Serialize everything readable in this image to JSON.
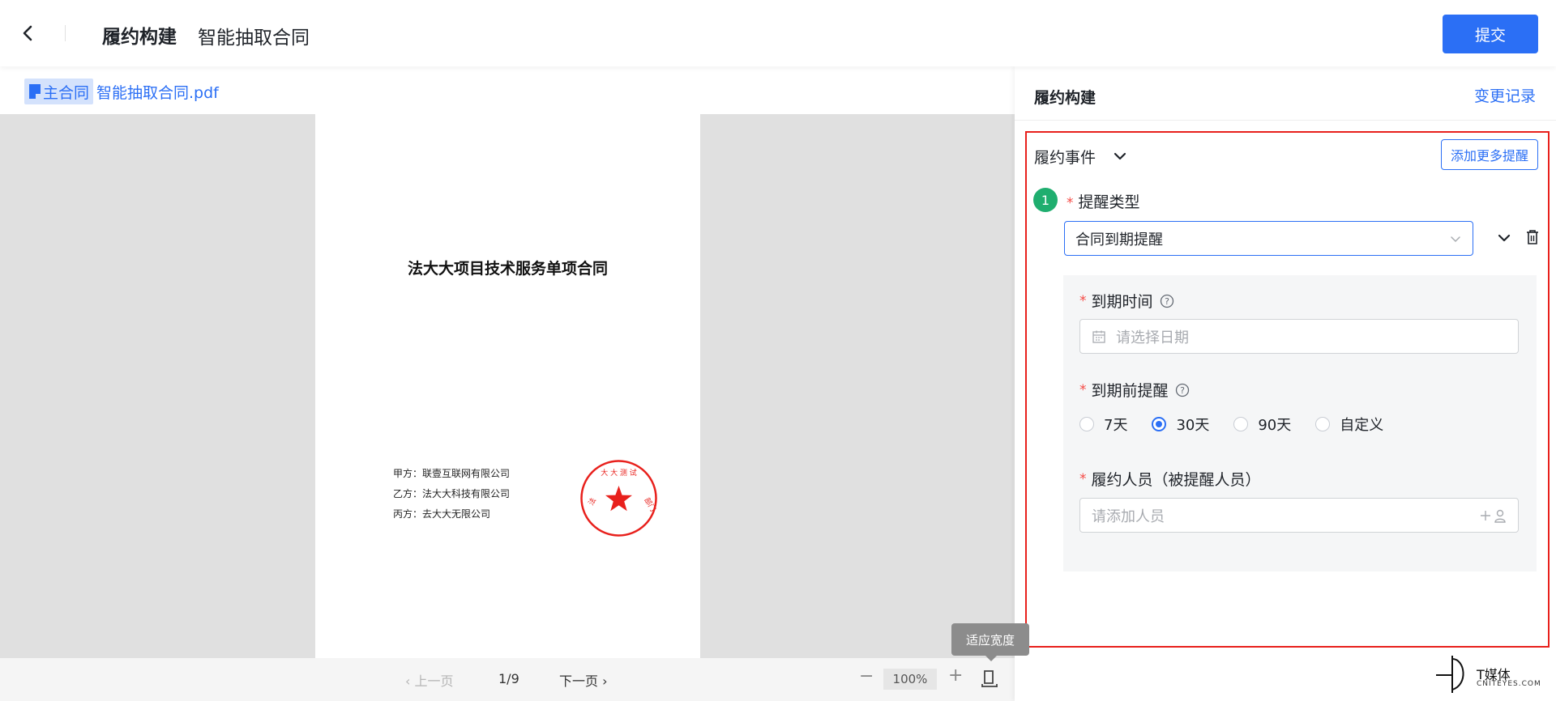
{
  "header": {
    "title": "履约构建",
    "subtitle": "智能抽取合同",
    "submit_label": "提交"
  },
  "file": {
    "tag_label": "主合同",
    "name": "智能抽取合同.pdf"
  },
  "document": {
    "title": "法大大项目技术服务单项合同",
    "parties": [
      "甲方：联壹互联网有限公司",
      "乙方：法大大科技有限公司",
      "丙方：去大大无限公司"
    ],
    "seal_text": "法大大测试部门"
  },
  "viewer_footer": {
    "prev_label": "上一页",
    "page_indicator": "1/9",
    "next_label": "下一页",
    "zoom_out": "−",
    "zoom_level": "100%",
    "zoom_in": "+",
    "tooltip": "适应宽度"
  },
  "panel": {
    "title": "履约构建",
    "change_log": "变更记录",
    "event_label": "履约事件",
    "add_reminder": "添加更多提醒",
    "step_number": "1",
    "reminder_type_label": "提醒类型",
    "reminder_type_value": "合同到期提醒",
    "due_date_label": "到期时间",
    "due_date_placeholder": "请选择日期",
    "pre_reminder_label": "到期前提醒",
    "pre_reminder_options": [
      "7天",
      "30天",
      "90天",
      "自定义"
    ],
    "pre_reminder_selected": "30天",
    "person_label": "履约人员（被提醒人员）",
    "person_placeholder": "请添加人员"
  },
  "watermark": {
    "text": "T媒体",
    "sub": "CNITEYES.COM"
  },
  "colors": {
    "accent": "#2b6ff5",
    "highlight": "#e8201c",
    "step_badge": "#1fae6f",
    "seal": "#e8201c"
  }
}
